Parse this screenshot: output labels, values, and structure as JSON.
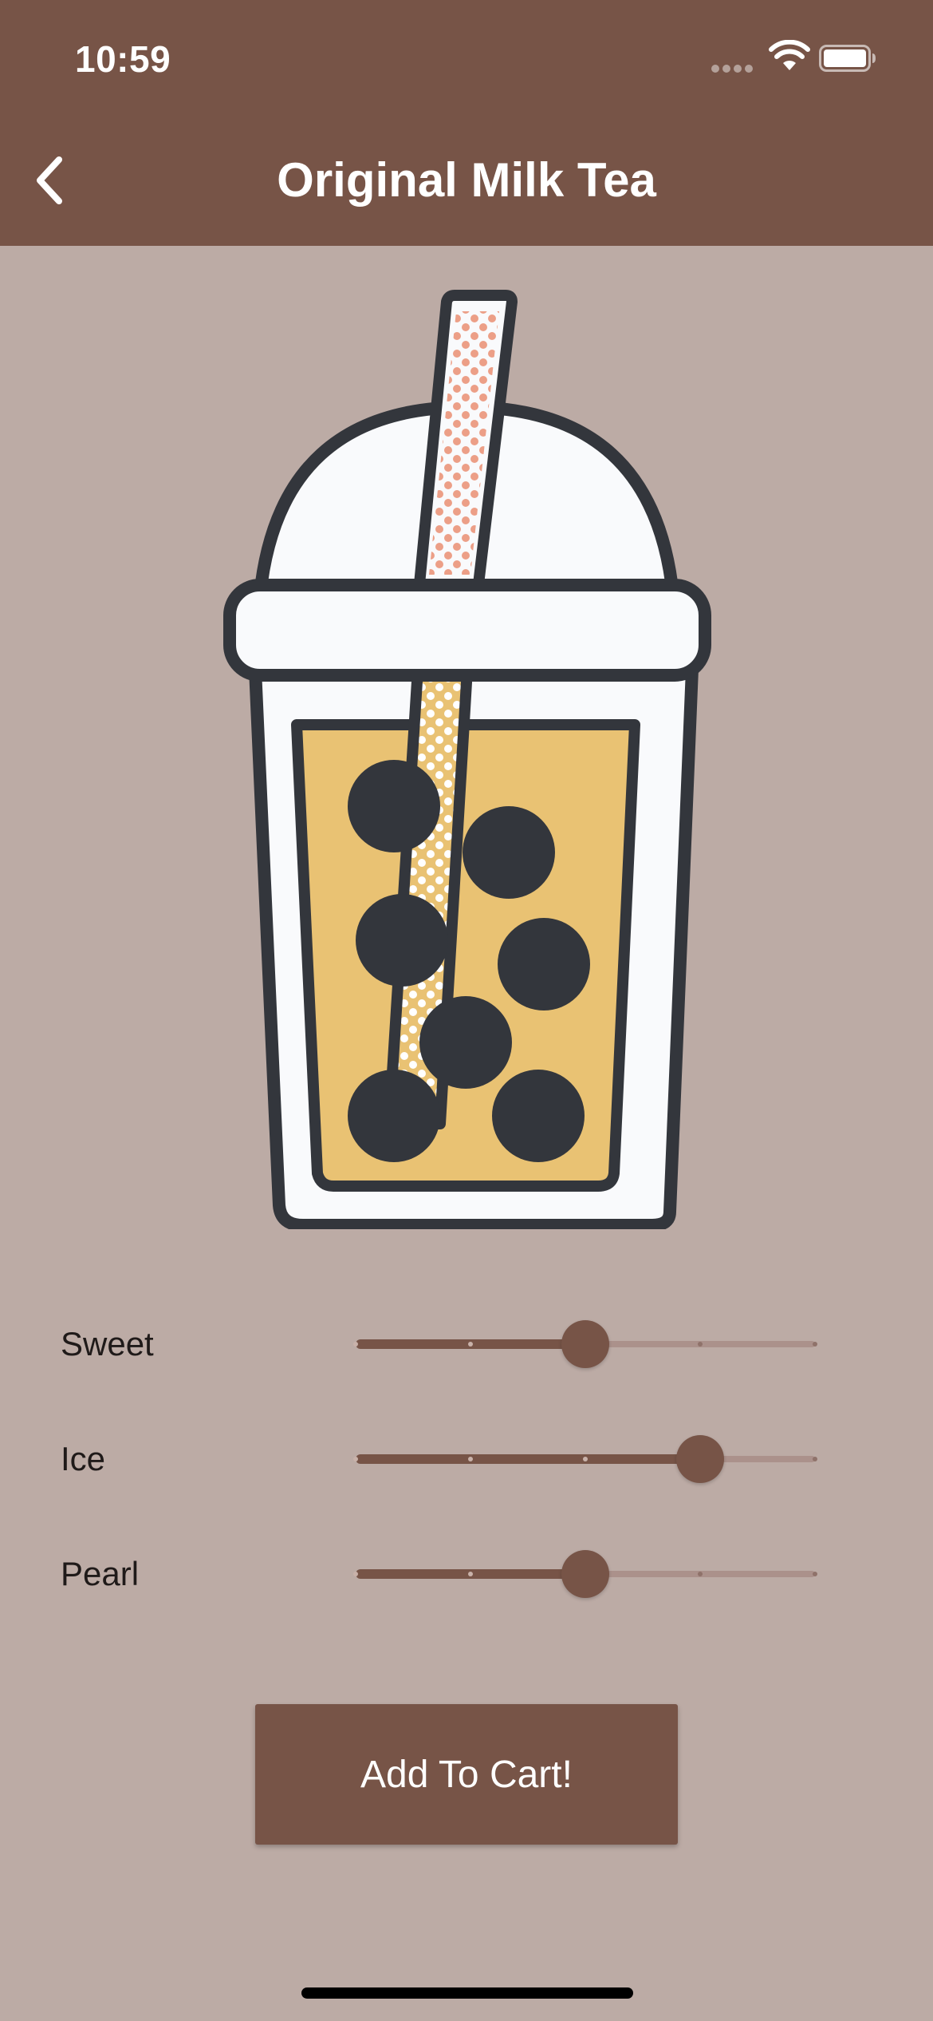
{
  "status_bar": {
    "time": "10:59"
  },
  "header": {
    "title": "Original Milk Tea",
    "back_icon": "chevron-left-icon"
  },
  "illustration": {
    "name": "bubble-tea-cup",
    "colors": {
      "outline": "#33363c",
      "cup": "#f9fafc",
      "tea": "#e9c273",
      "pearls": "#33363c",
      "straw_dots": "#ec9f87"
    }
  },
  "options": [
    {
      "label": "Sweet",
      "value": 2,
      "min": 0,
      "max": 4,
      "divisions": 4
    },
    {
      "label": "Ice",
      "value": 3,
      "min": 0,
      "max": 4,
      "divisions": 4
    },
    {
      "label": "Pearl",
      "value": 2,
      "min": 0,
      "max": 4,
      "divisions": 4
    }
  ],
  "cart_button": {
    "label": "Add To Cart!"
  },
  "colors": {
    "primary": "#775447",
    "background": "#bcaba5",
    "track_inactive": "#ab918b"
  }
}
